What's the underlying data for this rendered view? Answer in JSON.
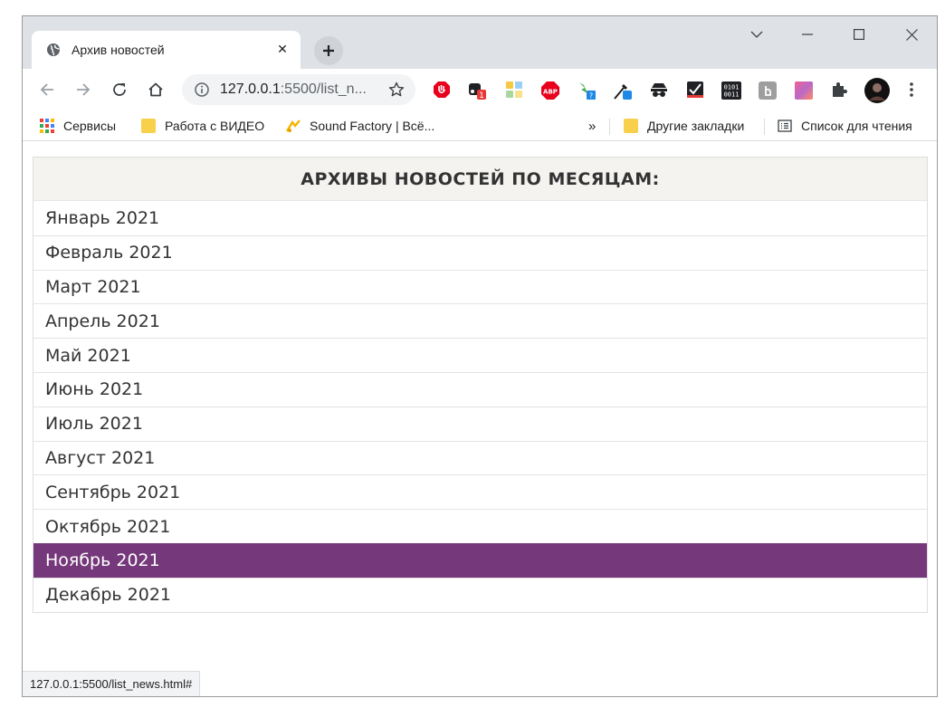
{
  "browser": {
    "tab_title": "Архив новостей",
    "url_host": "127.0.0.1",
    "url_rest": ":5500/list_n...",
    "bookmarks": {
      "apps": "Сервисы",
      "video": "Работа с ВИДЕО",
      "sound": "Sound Factory | Всё...",
      "more": "»",
      "other": "Другие закладки",
      "reading_list": "Список для чтения"
    },
    "extension_badge": "1",
    "status_url": "127.0.0.1:5500/list_news.html#"
  },
  "archive": {
    "heading": "АРХИВЫ НОВОСТЕЙ ПО МЕСЯЦАМ:",
    "months": [
      "Январь 2021",
      "Февраль 2021",
      "Март 2021",
      "Апрель 2021",
      "Май 2021",
      "Июнь 2021",
      "Июль 2021",
      "Август 2021",
      "Сентябрь 2021",
      "Октябрь 2021",
      "Ноябрь 2021",
      "Декабрь 2021"
    ],
    "active_month": "Ноябрь 2021"
  },
  "colors": {
    "active_bg": "#75387b",
    "header_bg": "#f4f3f0"
  }
}
